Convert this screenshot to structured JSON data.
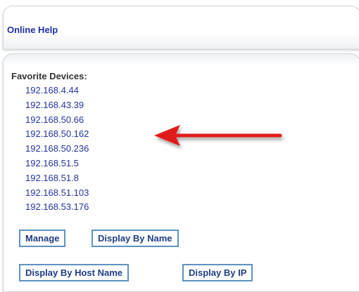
{
  "header": {
    "online_help": "Online Help"
  },
  "favorites": {
    "title": "Favorite Devices:",
    "devices": [
      "192.168.4.44",
      "192.168.43.39",
      "192.168.50.66",
      "192.168.50.162",
      "192.168.50.236",
      "192.168.51.5",
      "192.168.51.8",
      "192.168.51.103",
      "192.168.53.176"
    ]
  },
  "buttons": {
    "manage": "Manage",
    "display_by_name": "Display By Name",
    "display_by_host_name": "Display By Host Name",
    "display_by_ip": "Display By IP"
  },
  "annotation": {
    "arrow_color": "#e01b1b"
  }
}
